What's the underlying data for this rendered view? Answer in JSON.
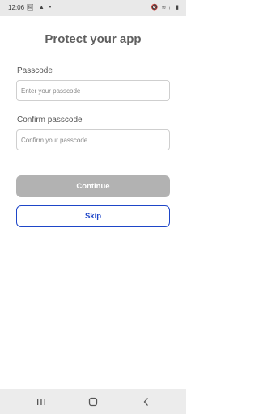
{
  "status_bar": {
    "time": "12:06",
    "left_icons": "🖼 ▲ •",
    "right_icons": "🔇 ≋ ᵢ| ▮"
  },
  "page": {
    "title": "Protect your app"
  },
  "form": {
    "passcode_label": "Passcode",
    "passcode_placeholder": "Enter your passcode",
    "confirm_label": "Confirm passcode",
    "confirm_placeholder": "Confirm your passcode"
  },
  "actions": {
    "continue_label": "Continue",
    "skip_label": "Skip"
  },
  "colors": {
    "accent": "#1e46c8",
    "disabled_button": "#b2b2b2"
  }
}
